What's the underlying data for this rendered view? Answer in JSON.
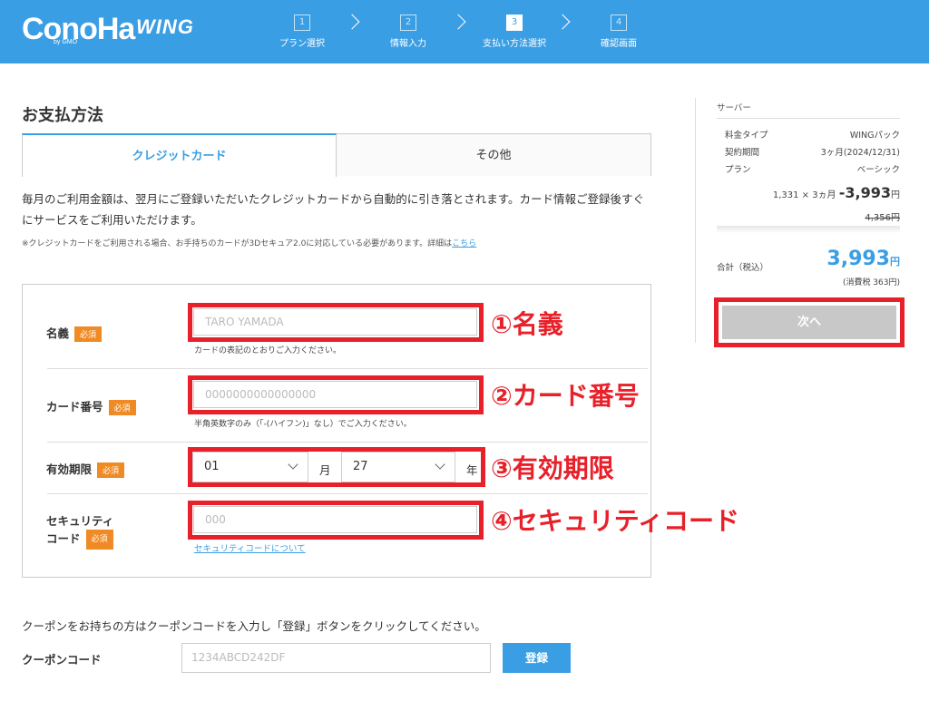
{
  "header": {
    "logo": "ConoHa",
    "logo_sub": "by GMO",
    "product": "WING",
    "steps": [
      {
        "num": "1",
        "label": "プラン選択"
      },
      {
        "num": "2",
        "label": "情報入力"
      },
      {
        "num": "3",
        "label": "支払い方法選択"
      },
      {
        "num": "4",
        "label": "確認画面"
      }
    ],
    "active_step": 3
  },
  "main": {
    "title": "お支払方法",
    "tabs": [
      {
        "label": "クレジットカード",
        "active": true
      },
      {
        "label": "その他",
        "active": false
      }
    ],
    "description": "毎月のご利用金額は、翌月にご登録いただいたクレジットカードから自動的に引き落とされます。カード情報ご登録後すぐにサービスをご利用いただけます。",
    "note": "※クレジットカードをご利用される場合、お手持ちのカードが3Dセキュア2.0に対応している必要があります。詳細は",
    "note_link": "こちら"
  },
  "form": {
    "required_label": "必須",
    "name": {
      "label": "名義",
      "placeholder": "TARO YAMADA",
      "hint": "カードの表記のとおりご入力ください。",
      "annotation": "①名義"
    },
    "card_number": {
      "label": "カード番号",
      "placeholder": "0000000000000000",
      "hint": "半角英数字のみ（「-(ハイフン)」なし）でご入力ください。",
      "annotation": "②カード番号"
    },
    "expiry": {
      "label": "有効期限",
      "month_value": "01",
      "month_unit": "月",
      "year_value": "27",
      "year_unit": "年",
      "annotation": "③有効期限"
    },
    "security": {
      "label_line1": "セキュリティ",
      "label_line2": "コード",
      "placeholder": "000",
      "link": "セキュリティコードについて",
      "annotation": "④セキュリティコード"
    }
  },
  "coupon": {
    "text": "クーポンをお持ちの方はクーポンコードを入力し「登録」ボタンをクリックしてください。",
    "label": "クーポンコード",
    "placeholder": "1234ABCD242DF",
    "button": "登録"
  },
  "sidebar": {
    "section": "サーバー",
    "rows": [
      {
        "key": "料金タイプ",
        "value": "WINGパック"
      },
      {
        "key": "契約期間",
        "value": "3ヶ月(2024/12/31)"
      },
      {
        "key": "プラン",
        "value": "ベーシック"
      }
    ],
    "calc": "1,331 × 3ヵ月",
    "price": "-3,993",
    "price_unit": "円",
    "old_price": "4,356円",
    "total_label": "合計（税込）",
    "total_value": "3,993",
    "total_unit": "円",
    "tax_note": "(消費税 363円)",
    "next_button": "次へ"
  },
  "colors": {
    "brand": "#3a9ee4",
    "required": "#f08a24",
    "highlight": "#e8202a",
    "disabled": "#c8c8c8"
  }
}
